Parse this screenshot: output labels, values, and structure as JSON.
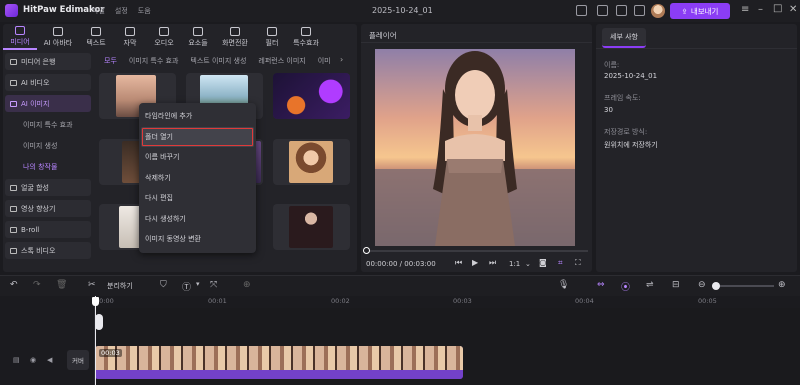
{
  "app": {
    "name": "HitPaw Edimakor",
    "doc_title": "2025-10-24_01",
    "export_label": "내보내기",
    "menu": [
      "파일",
      "설정",
      "도움"
    ]
  },
  "tool_tabs": [
    {
      "label": "미디어",
      "icon": "media-icon",
      "active": true
    },
    {
      "label": "AI 아바타",
      "icon": "avatar-icon"
    },
    {
      "label": "텍스트",
      "icon": "text-icon"
    },
    {
      "label": "자막",
      "icon": "subtitle-icon"
    },
    {
      "label": "오디오",
      "icon": "music-icon"
    },
    {
      "label": "요소들",
      "icon": "elements-icon"
    },
    {
      "label": "화면전환",
      "icon": "transition-icon"
    },
    {
      "label": "필터",
      "icon": "filter-icon"
    },
    {
      "label": "특수효과",
      "icon": "effects-icon"
    }
  ],
  "sidebar": {
    "items": [
      {
        "label": "미디어 은행",
        "icon": "folder-icon"
      },
      {
        "label": "AI 비디오",
        "icon": "ai-video-icon"
      },
      {
        "label": "AI 이미지",
        "icon": "ai-image-icon",
        "active": true
      }
    ],
    "subitems": [
      {
        "label": "이미지 특수 효과"
      },
      {
        "label": "이미지 생성"
      },
      {
        "label": "나의 창작물",
        "active": true
      }
    ],
    "more": [
      {
        "label": "얼굴 합성",
        "icon": "face-swap-icon"
      },
      {
        "label": "영상 향상기",
        "icon": "enhance-icon"
      },
      {
        "label": "B-roll",
        "icon": "broll-icon"
      },
      {
        "label": "스톡 비디오",
        "icon": "stock-video-icon"
      }
    ]
  },
  "content_tabs": [
    "모두",
    "이미지 특수 효과",
    "텍스트 이미지 생성",
    "레퍼런스 이미지",
    "이미"
  ],
  "context_menu": [
    "타임라인에 추가",
    "폴더 열기",
    "이름 바꾸기",
    "삭제하기",
    "다시 편집",
    "다시 생성하기",
    "이미지 동영상 변환"
  ],
  "player": {
    "title": "플레이어",
    "time": "00:00:00 / 00:03:00",
    "speed": "1:1",
    "progress": 0.0
  },
  "properties": {
    "tab": "세부 사항",
    "name_label": "이름:",
    "name_value": "2025-10-24_01",
    "fps_label": "프레임 속도:",
    "fps_value": "30",
    "loc_label": "저장경로 방식:",
    "loc_value": "원위치에 저장하기"
  },
  "timeline": {
    "split_label": "분리하기",
    "ticks": [
      "00:00",
      "00:01",
      "00:02",
      "00:03",
      "00:04",
      "00:05"
    ],
    "clip_label": "00:03",
    "cover_label": "커버"
  },
  "colors": {
    "accent": "#8b3df5",
    "highlight": "#e03a3a",
    "clip": "#7341c9"
  }
}
